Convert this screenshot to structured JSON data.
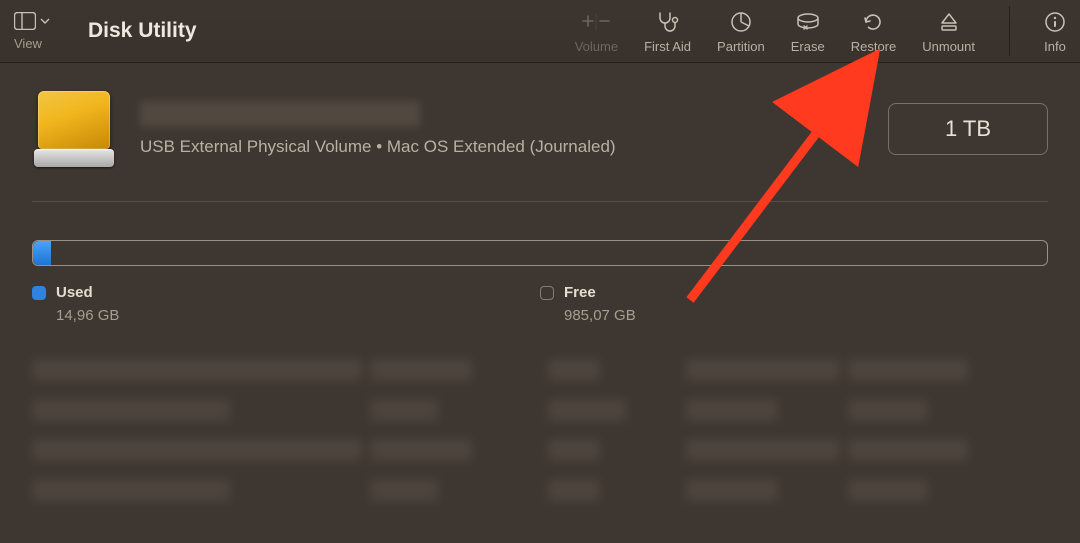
{
  "toolbar": {
    "view_label": "View",
    "title": "Disk Utility",
    "items": {
      "volume": "Volume",
      "first_aid": "First Aid",
      "partition": "Partition",
      "erase": "Erase",
      "restore": "Restore",
      "unmount": "Unmount",
      "info": "Info"
    }
  },
  "volume": {
    "subtitle": "USB External Physical Volume • Mac OS Extended (Journaled)",
    "capacity": "1 TB"
  },
  "usage": {
    "used_label": "Used",
    "used_value": "14,96 GB",
    "free_label": "Free",
    "free_value": "985,07 GB"
  },
  "colors": {
    "accent_blue": "#2f83e0",
    "drive_yellow": "#e6a60f",
    "annotation_red": "#ff3a1e"
  }
}
